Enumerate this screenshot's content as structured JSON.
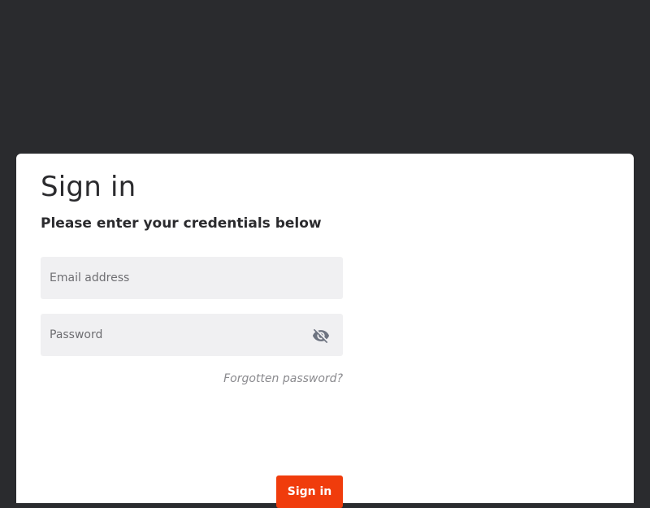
{
  "modal": {
    "title": "Sign in",
    "subtitle": "Please enter your credentials below"
  },
  "form": {
    "email": {
      "placeholder": "Email address",
      "value": ""
    },
    "password": {
      "placeholder": "Password",
      "value": "",
      "toggle_icon": "eye-off-icon"
    },
    "forgot_password_label": "Forgotten password?",
    "submit_label": "Sign in"
  },
  "colors": {
    "backdrop": "#2a2b2e",
    "accent": "#f03c0c",
    "field_background": "#f0f0f2"
  }
}
